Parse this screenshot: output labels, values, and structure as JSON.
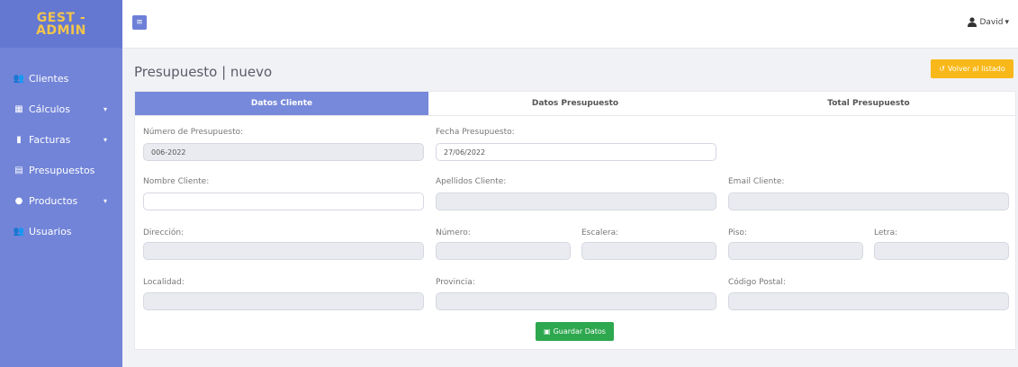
{
  "brand": {
    "line1": "GEST -",
    "line2": "ADMIN"
  },
  "sidebar": {
    "items": [
      {
        "label": "Clientes",
        "icon": "users-icon",
        "glyph": "👥",
        "has_caret": false
      },
      {
        "label": "Cálculos",
        "icon": "calculator-icon",
        "glyph": "▦",
        "has_caret": true
      },
      {
        "label": "Facturas",
        "icon": "file-icon",
        "glyph": "▮",
        "has_caret": true
      },
      {
        "label": "Presupuestos",
        "icon": "file-text-icon",
        "glyph": "▤",
        "has_caret": false
      },
      {
        "label": "Productos",
        "icon": "product-icon",
        "glyph": "●",
        "has_caret": true
      },
      {
        "label": "Usuarios",
        "icon": "users-cog-icon",
        "glyph": "👥",
        "has_caret": false
      }
    ],
    "caret": "▾"
  },
  "topbar": {
    "menu_glyph": "≡",
    "user_name": "David",
    "user_caret": "▾"
  },
  "page": {
    "title": "Presupuesto | nuevo",
    "back_label": "Volver al listado",
    "back_glyph": "↺"
  },
  "tabs": [
    {
      "label": "Datos Cliente",
      "active": true
    },
    {
      "label": "Datos Presupuesto",
      "active": false
    },
    {
      "label": "Total Presupuesto",
      "active": false
    }
  ],
  "form": {
    "numero_presupuesto": {
      "label": "Número de Presupuesto:",
      "value": "006-2022"
    },
    "fecha_presupuesto": {
      "label": "Fecha Presupuesto:",
      "value": "27/06/2022"
    },
    "nombre_cliente": {
      "label": "Nombre Cliente:",
      "value": ""
    },
    "apellidos_cliente": {
      "label": "Apellidos Cliente:",
      "value": ""
    },
    "email_cliente": {
      "label": "Email Cliente:",
      "value": ""
    },
    "direccion": {
      "label": "Dirección:",
      "value": ""
    },
    "numero": {
      "label": "Número:",
      "value": ""
    },
    "escalera": {
      "label": "Escalera:",
      "value": ""
    },
    "piso": {
      "label": "Piso:",
      "value": ""
    },
    "letra": {
      "label": "Letra:",
      "value": ""
    },
    "localidad": {
      "label": "Localidad:",
      "value": ""
    },
    "provincia": {
      "label": "Provincia:",
      "value": ""
    },
    "codigo_postal": {
      "label": "Código Postal:",
      "value": ""
    }
  },
  "save_button": {
    "label": "Guardar Datos",
    "glyph": "▣"
  },
  "colors": {
    "sidebar": "#7284d8",
    "accent": "#7789da",
    "warning": "#f8b819",
    "success": "#2ea84f",
    "brand_text": "#f3c54a"
  }
}
